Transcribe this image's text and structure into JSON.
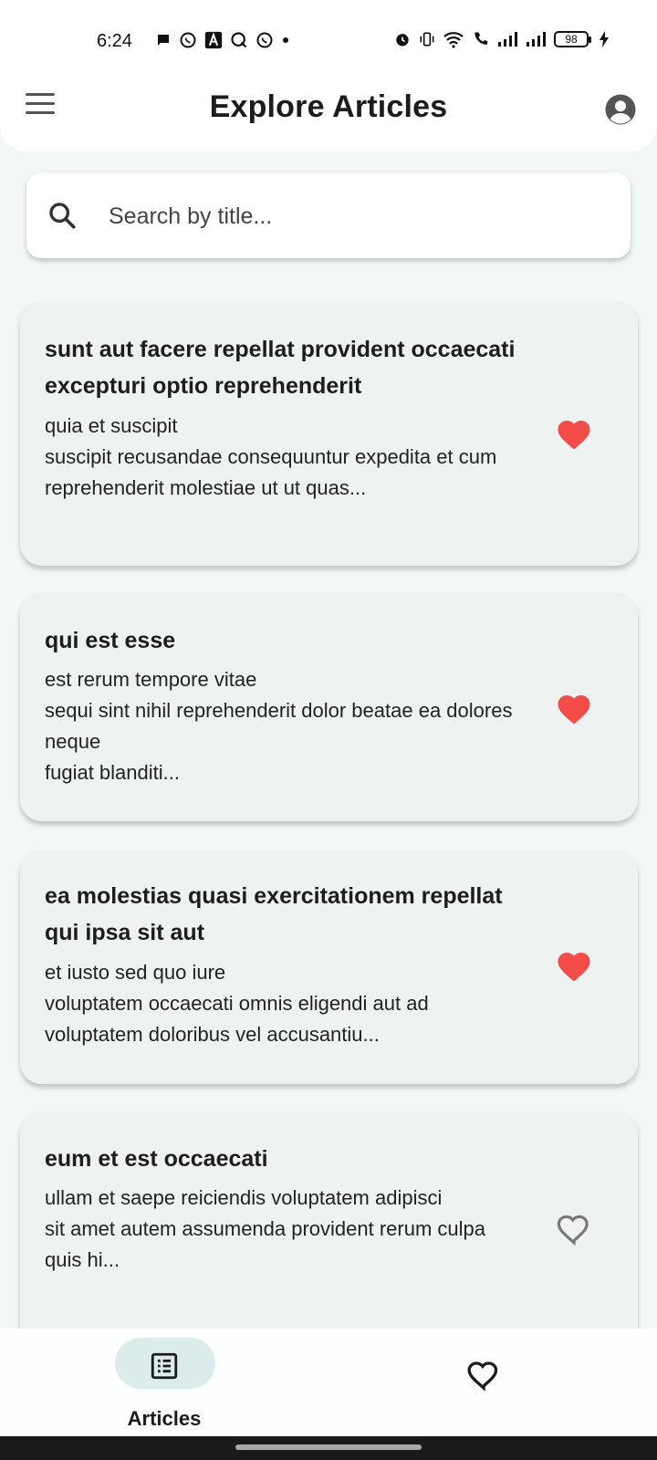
{
  "status_bar": {
    "time": "6:24",
    "battery": "98",
    "notification_icons": [
      "chat-bubble-icon",
      "whatsapp-icon",
      "app-a-icon",
      "q-icon",
      "whatsapp-icon",
      "dot-icon"
    ],
    "system_icons": [
      "alarm-icon",
      "vibrate-icon",
      "wifi-icon",
      "wifi-calling-icon",
      "signal-icon",
      "signal-icon",
      "battery-icon",
      "charging-icon"
    ]
  },
  "app_bar": {
    "title": "Explore Articles",
    "menu_icon": "hamburger-menu-icon",
    "account_icon": "account-circle-icon"
  },
  "search": {
    "placeholder": "Search by title...",
    "value": "",
    "icon": "search-icon"
  },
  "articles": [
    {
      "title": "sunt aut facere repellat provident occaecati excepturi optio reprehenderit",
      "body": "quia et suscipit\nsuscipit recusandae consequuntur expedita et cum\nreprehenderit molestiae ut ut quas...",
      "favorited": true
    },
    {
      "title": "qui est esse",
      "body": "est rerum tempore vitae\nsequi sint nihil reprehenderit dolor beatae ea dolores neque\nfugiat blanditi...",
      "favorited": true
    },
    {
      "title": "ea molestias quasi exercitationem repellat qui ipsa sit aut",
      "body": "et iusto sed quo iure\nvoluptatem occaecati omnis eligendi aut ad\nvoluptatem doloribus vel accusantiu...",
      "favorited": true
    },
    {
      "title": "eum et est occaecati",
      "body": "ullam et saepe reiciendis voluptatem adipisci\nsit amet autem assumenda provident rerum culpa\nquis hi...",
      "favorited": false
    }
  ],
  "bottom_nav": {
    "articles_label": "Articles",
    "articles_icon": "article-list-icon",
    "favorites_icon": "heart-outline-icon"
  },
  "colors": {
    "favorite": "#f44b4b",
    "unfavorite": "#777777",
    "nav_active_pill": "#dcecea",
    "card_background": "#eef3f2"
  }
}
